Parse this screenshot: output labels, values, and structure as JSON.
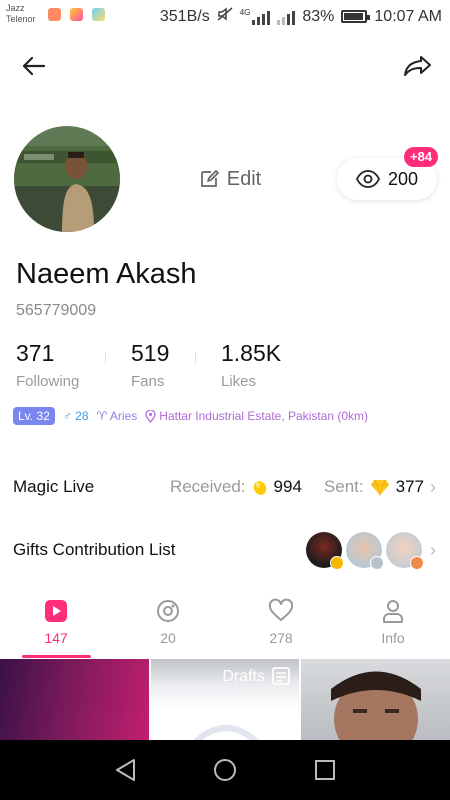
{
  "status_bar": {
    "carrier_line1": "Jazz",
    "carrier_line2": "Telenor",
    "speed": "351B/s",
    "network": "4G",
    "battery": "83%",
    "battery_level": 0.83,
    "time": "10:07 AM"
  },
  "profile": {
    "edit_label": "Edit",
    "views": "200",
    "views_new": "+84",
    "name": "Naeem Akash",
    "id": "565779009",
    "stats": [
      {
        "value": "371",
        "label": "Following"
      },
      {
        "value": "519",
        "label": "Fans"
      },
      {
        "value": "1.85K",
        "label": "Likes"
      }
    ],
    "level": "Lv. 32",
    "gender_age": "♂ 28",
    "zodiac": "♈ Aries",
    "location": "Hattar Industrial Estate, Pakistan (0km)"
  },
  "magic_live": {
    "title": "Magic Live",
    "received_label": "Received:",
    "received_value": "994",
    "sent_label": "Sent:",
    "sent_value": "377"
  },
  "gifts": {
    "title": "Gifts Contribution List"
  },
  "tabs": [
    {
      "label": "147",
      "icon": "video-icon",
      "active": true
    },
    {
      "label": "20",
      "icon": "live-icon",
      "active": false
    },
    {
      "label": "278",
      "icon": "heart-icon",
      "active": false
    },
    {
      "label": "Info",
      "icon": "person-icon",
      "active": false
    }
  ],
  "grid": {
    "drafts_label": "Drafts"
  },
  "colors": {
    "accent": "#ff2d7a",
    "level_badge": "#7a86f0",
    "location": "#b06ad8"
  }
}
